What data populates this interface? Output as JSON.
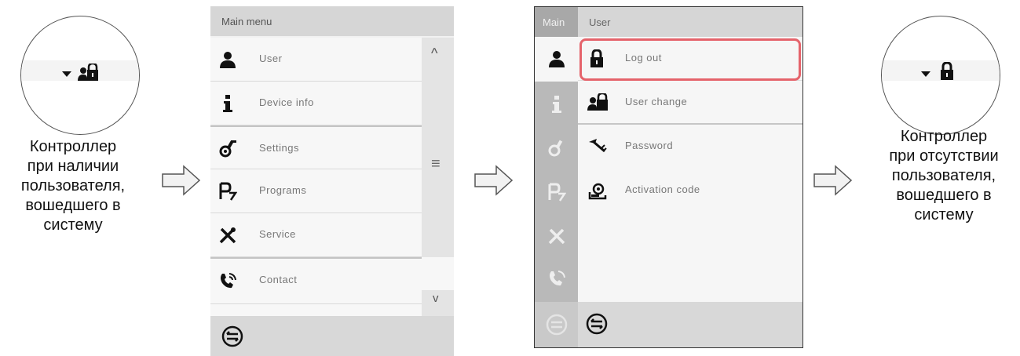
{
  "left_caption": [
    "Контроллер",
    "при наличии",
    "пользователя,",
    "вошедшего в",
    "систему"
  ],
  "right_caption": [
    "Контроллер",
    "при отсутствии",
    "пользователя,",
    "вошедшего в",
    "систему"
  ],
  "main_menu": {
    "title": "Main menu",
    "items": [
      {
        "label": "User",
        "icon": "user-icon"
      },
      {
        "label": "Device info",
        "icon": "info-icon"
      },
      {
        "label": "Settings",
        "icon": "settings-icon"
      },
      {
        "label": "Programs",
        "icon": "programs-icon"
      },
      {
        "label": "Service",
        "icon": "service-icon"
      },
      {
        "label": "Contact",
        "icon": "contact-icon"
      }
    ],
    "scroll_up": "^",
    "scroll_mid": "≡",
    "scroll_down": "v"
  },
  "user_menu": {
    "side_title": "Main",
    "title": "User",
    "items": [
      {
        "label": "Log out",
        "icon": "lock-icon"
      },
      {
        "label": "User change",
        "icon": "user-change-icon"
      },
      {
        "label": "Password",
        "icon": "password-icon"
      },
      {
        "label": "Activation code",
        "icon": "activation-code-icon"
      }
    ]
  },
  "colors": {
    "highlight": "#e5636b",
    "header": "#d6d6d6",
    "sidebar": "#b9b9b9"
  }
}
